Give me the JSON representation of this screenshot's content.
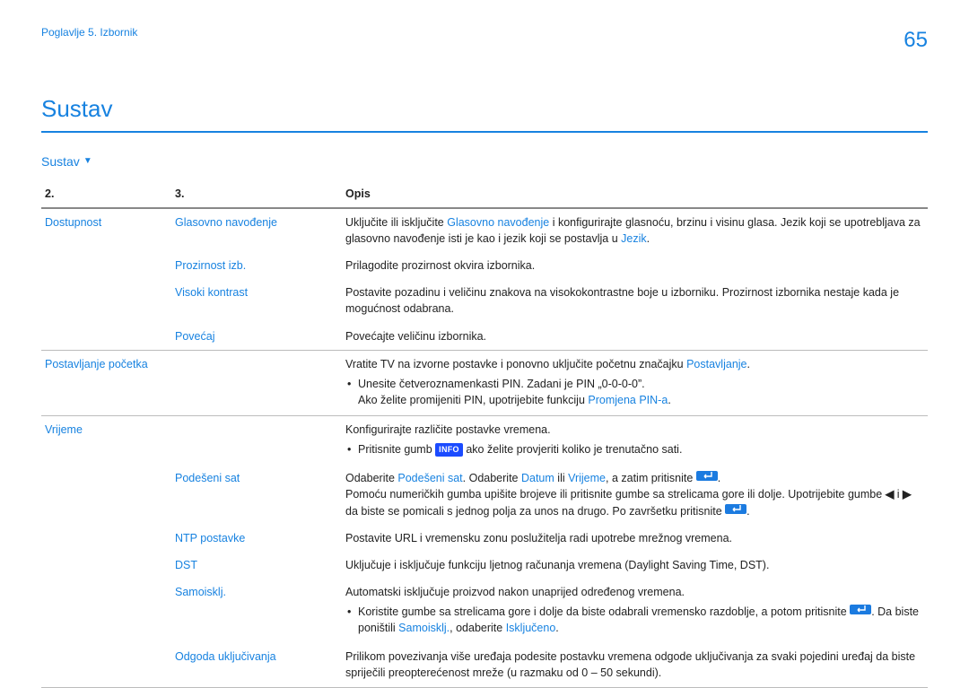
{
  "header": {
    "chapter": "Poglavlje 5. Izbornik",
    "page": "65",
    "title": "Sustav",
    "subhead": "Sustav"
  },
  "table": {
    "h2": "2.",
    "h3": "3.",
    "hDesc": "Opis"
  },
  "rows": {
    "dostupnost": "Dostupnost",
    "glasovno": "Glasovno navođenje",
    "glasovno_desc_a": "Uključite ili isključite ",
    "glasovno_desc_b": "Glasovno navođenje",
    "glasovno_desc_c": " i konfigurirajte glasnoću, brzinu i visinu glasa. Jezik koji se upotrebljava za glasovno navođenje isti je kao i jezik koji se postavlja u ",
    "glasovno_desc_d": "Jezik",
    "glasovno_desc_e": ".",
    "prozirnost": "Prozirnost izb.",
    "prozirnost_desc": "Prilagodite prozirnost okvira izbornika.",
    "visoki": "Visoki kontrast",
    "visoki_desc": "Postavite pozadinu i veličinu znakova na visokokontrastne boje u izborniku. Prozirnost izbornika nestaje kada je mogućnost odabrana.",
    "povecaj": "Povećaj",
    "povecaj_desc": "Povećajte veličinu izbornika.",
    "postavljanje_pocetka": "Postavljanje početka",
    "postavljanje_desc_a": "Vratite TV na izvorne postavke i ponovno uključite početnu značajku ",
    "postavljanje_desc_b": "Postavljanje",
    "postavljanje_desc_c": ".",
    "postavljanje_b1": "Unesite četveroznamenkasti PIN. Zadani je PIN „0-0-0-0”.",
    "postavljanje_b2a": "Ako želite promijeniti PIN, upotrijebite funkciju ",
    "postavljanje_b2b": "Promjena PIN-a",
    "postavljanje_b2c": ".",
    "vrijeme": "Vrijeme",
    "vrijeme_desc": "Konfigurirajte različite postavke vremena.",
    "vrijeme_b1a": "Pritisnite gumb ",
    "vrijeme_b1_badge": "INFO",
    "vrijeme_b1b": " ako želite provjeriti koliko je trenutačno sati.",
    "podeseni": "Podešeni sat",
    "podeseni_a": "Odaberite ",
    "podeseni_b": "Podešeni sat",
    "podeseni_c": ". Odaberite ",
    "podeseni_d": "Datum",
    "podeseni_e": " ili ",
    "podeseni_f": "Vrijeme",
    "podeseni_g": ", a zatim pritisnite ",
    "podeseni_h": ".",
    "podeseni_l2a": "Pomoću numeričkih gumba upišite brojeve ili pritisnite gumbe sa strelicama gore ili dolje. Upotrijebite gumbe ",
    "podeseni_l2b": " i ",
    "podeseni_l2c": " da biste se pomicali s jednog polja za unos na drugo. Po završetku pritisnite ",
    "podeseni_l2d": ".",
    "ntp": "NTP postavke",
    "ntp_desc": "Postavite URL i vremensku zonu poslužitelja radi upotrebe mrežnog vremena.",
    "dst": "DST",
    "dst_desc": "Uključuje i isključuje funkciju ljetnog računanja vremena (Daylight Saving Time, DST).",
    "samoisklj": "Samoisklj.",
    "samoisklj_desc": "Automatski isključuje proizvod nakon unaprijed određenog vremena.",
    "samoisklj_b1a": "Koristite gumbe sa strelicama gore i dolje da biste odabrali vremensko razdoblje, a potom pritisnite ",
    "samoisklj_b1b": ". Da biste poništili ",
    "samoisklj_b1c": "Samoisklj.",
    "samoisklj_b1d": ", odaberite ",
    "samoisklj_b1e": "Isključeno",
    "samoisklj_b1f": ".",
    "odgoda": "Odgoda uključivanja",
    "odgoda_desc": "Prilikom povezivanja više uređaja podesite postavku vremena odgode uključivanja za svaki pojedini uređaj da biste spriječili preopterećenost mreže (u razmaku od 0 – 50 sekundi)."
  }
}
